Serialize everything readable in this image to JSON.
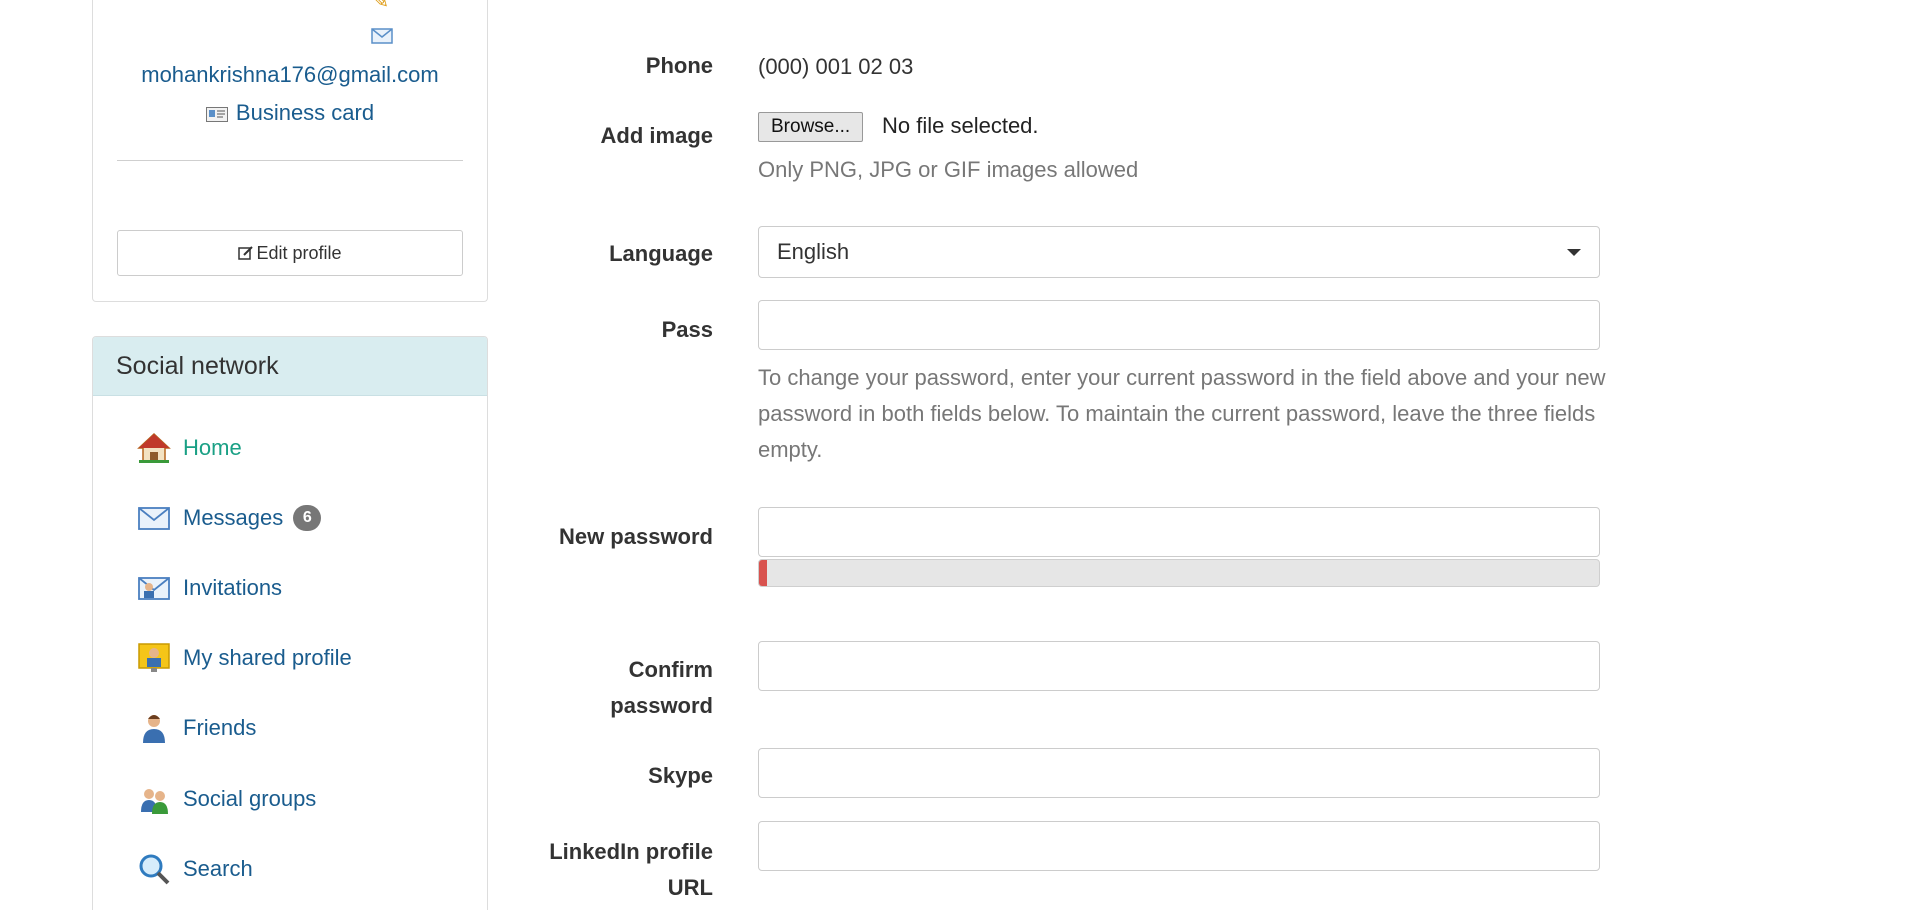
{
  "profile": {
    "email": "mohankrishna176@gmail.com",
    "business_card_label": "Business card",
    "edit_profile_label": "Edit profile"
  },
  "social": {
    "header": "Social network",
    "items": [
      {
        "label": "Home",
        "icon": "home-icon",
        "active": true
      },
      {
        "label": "Messages",
        "icon": "envelope-icon",
        "badge": "6"
      },
      {
        "label": "Invitations",
        "icon": "invitation-icon"
      },
      {
        "label": "My shared profile",
        "icon": "shared-profile-icon"
      },
      {
        "label": "Friends",
        "icon": "friend-icon"
      },
      {
        "label": "Social groups",
        "icon": "groups-icon"
      },
      {
        "label": "Search",
        "icon": "search-icon"
      }
    ]
  },
  "form": {
    "phone_label": "Phone",
    "phone_value": "(000) 001 02 03",
    "add_image_label": "Add image",
    "browse_label": "Browse...",
    "file_status": "No file selected.",
    "image_help": "Only PNG, JPG or GIF images allowed",
    "language_label": "Language",
    "language_value": "English",
    "pass_label": "Pass",
    "pass_help": "To change your password, enter your current password in the field above and your new password in both fields below. To maintain the current password, leave the three fields empty.",
    "new_password_label": "New password",
    "password_strength": 0.01,
    "confirm_password_label": "Confirm password",
    "skype_label": "Skype",
    "linkedin_label": "LinkedIn profile URL"
  },
  "colors": {
    "link": "#1a5c8e",
    "active_link": "#1aa085",
    "header_bg": "#d9edf0",
    "strength_weak": "#d9534f",
    "badge_bg": "#777777"
  }
}
